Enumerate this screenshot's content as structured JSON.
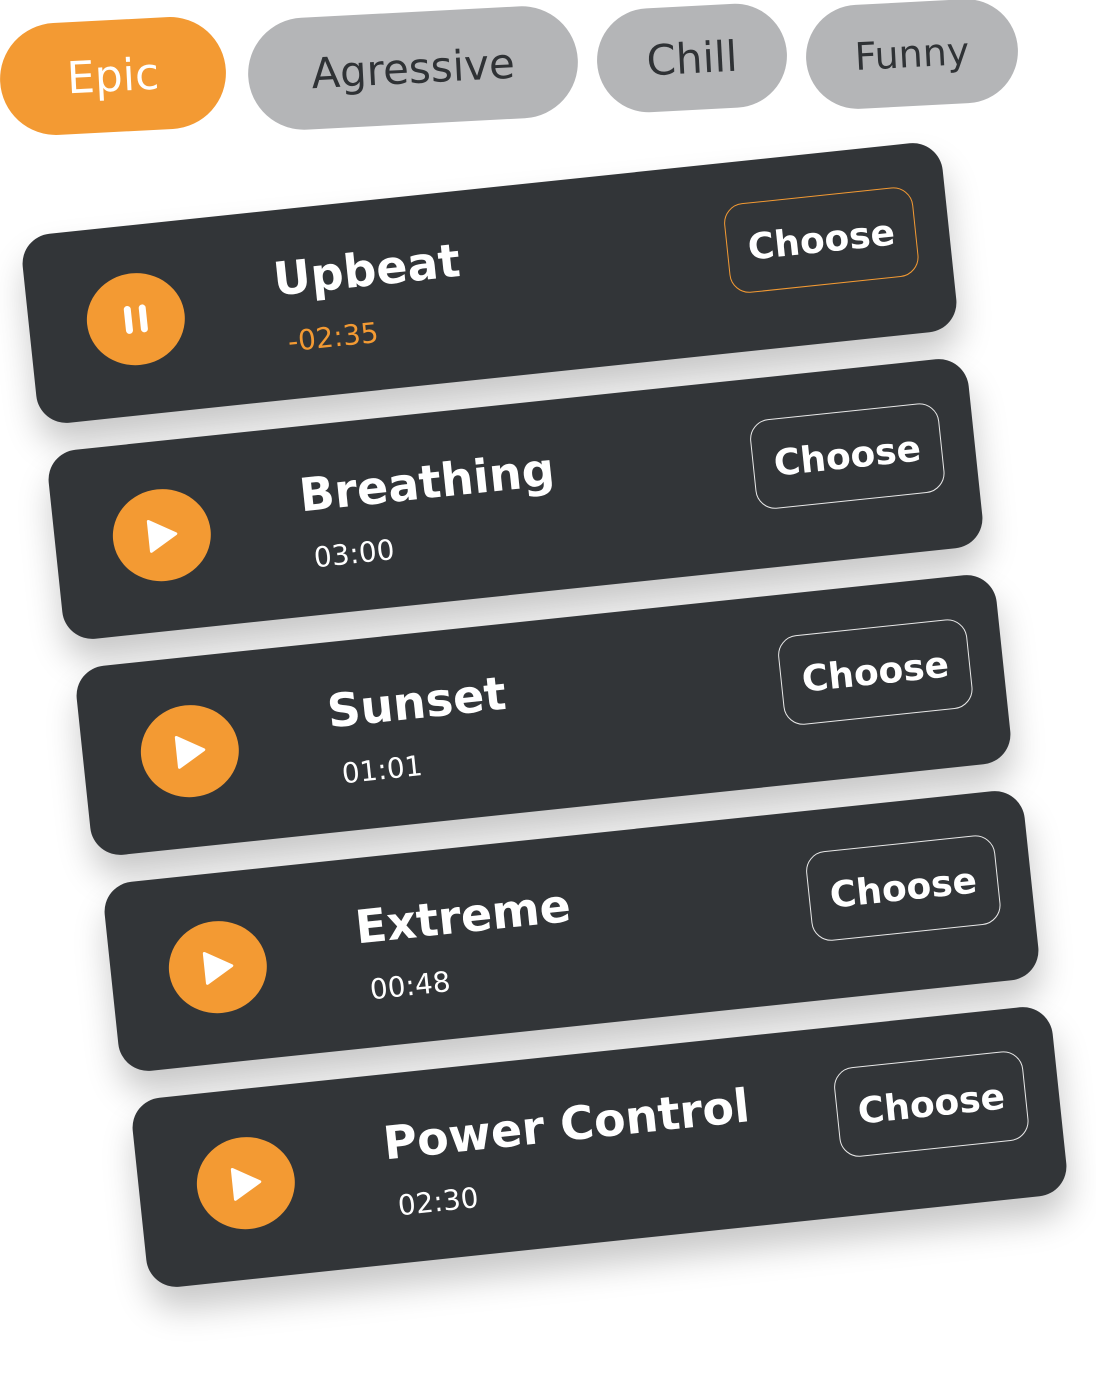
{
  "categories": {
    "items": [
      {
        "label": "Epic",
        "active": true
      },
      {
        "label": "Agressive",
        "active": false
      },
      {
        "label": "Chill",
        "active": false
      },
      {
        "label": "Funny",
        "active": false
      }
    ]
  },
  "tracks": [
    {
      "title": "Upbeat",
      "time": "-02:35",
      "state": "playing",
      "button_label": "Choose",
      "control_icon": "pause-icon"
    },
    {
      "title": "Breathing",
      "time": "03:00",
      "state": "paused",
      "button_label": "Choose",
      "control_icon": "play-icon"
    },
    {
      "title": "Sunset",
      "time": "01:01",
      "state": "paused",
      "button_label": "Choose",
      "control_icon": "play-icon"
    },
    {
      "title": "Extreme",
      "time": "00:48",
      "state": "paused",
      "button_label": "Choose",
      "control_icon": "play-icon"
    },
    {
      "title": "Power Control",
      "time": "02:30",
      "state": "paused",
      "button_label": "Choose",
      "control_icon": "play-icon"
    }
  ],
  "colors": {
    "accent": "#f39a33",
    "card_background": "#323538",
    "pill_inactive": "#b4b5b7",
    "text_dark": "#2f3235"
  }
}
